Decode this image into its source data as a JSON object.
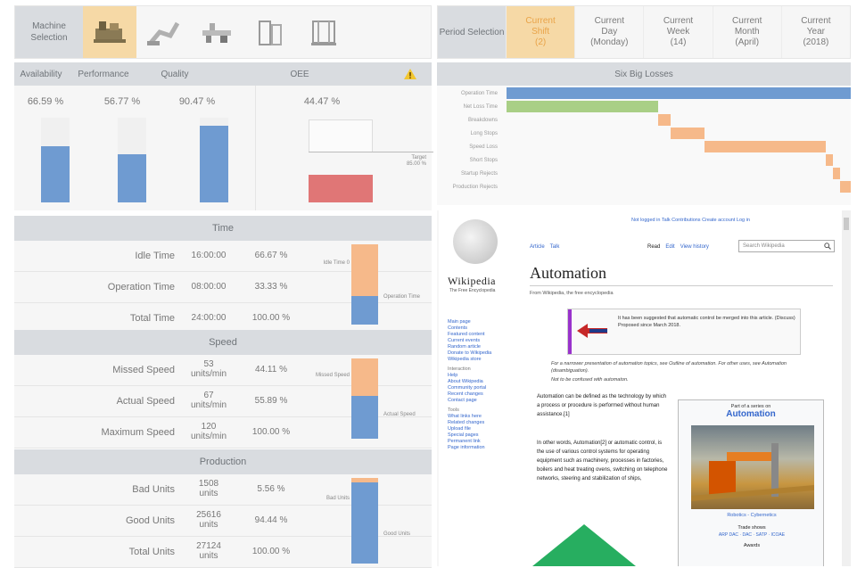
{
  "machine_selection": {
    "label": "Machine Selection"
  },
  "period_selection": {
    "label": "Period Selection",
    "items": [
      {
        "l1": "Current",
        "l2": "Shift",
        "l3": "(2)",
        "active": true
      },
      {
        "l1": "Current",
        "l2": "Day",
        "l3": "(Monday)"
      },
      {
        "l1": "Current",
        "l2": "Week",
        "l3": "(14)"
      },
      {
        "l1": "Current",
        "l2": "Month",
        "l3": "(April)"
      },
      {
        "l1": "Current",
        "l2": "Year",
        "l3": "(2018)"
      }
    ]
  },
  "kpi": {
    "headers": [
      "Availability",
      "Performance",
      "Quality",
      "OEE"
    ],
    "availability": "66.59 %",
    "performance": "56.77 %",
    "quality": "90.47 %",
    "oee": "44.47 %",
    "target_label": "Target",
    "target_value": "85.00 %",
    "warning_icon": "warning-icon"
  },
  "chart_data": {
    "type": "bar",
    "categories": [
      "Availability",
      "Performance",
      "Quality",
      "OEE"
    ],
    "values": [
      66.59,
      56.77,
      90.47,
      44.47
    ],
    "ylim": [
      0,
      100
    ]
  },
  "time": {
    "header": "Time",
    "rows": [
      {
        "label": "Idle Time",
        "value": "16:00:00",
        "pct": "66.67 %"
      },
      {
        "label": "Operation Time",
        "value": "08:00:00",
        "pct": "33.33 %"
      },
      {
        "label": "Total Time",
        "value": "24:00:00",
        "pct": "100.00 %"
      }
    ],
    "legend_top": "Idle Time 0",
    "legend_bottom": "Operation Time"
  },
  "speed": {
    "header": "Speed",
    "rows": [
      {
        "label": "Missed Speed",
        "v1": "53",
        "v2": "units/min",
        "pct": "44.11 %"
      },
      {
        "label": "Actual Speed",
        "v1": "67",
        "v2": "units/min",
        "pct": "55.89 %"
      },
      {
        "label": "Maximum Speed",
        "v1": "120",
        "v2": "units/min",
        "pct": "100.00 %"
      }
    ],
    "legend_top": "Missed Speed",
    "legend_bottom": "Actual Speed"
  },
  "production": {
    "header": "Production",
    "rows": [
      {
        "label": "Bad Units",
        "v1": "1508",
        "v2": "units",
        "pct": "5.56 %"
      },
      {
        "label": "Good Units",
        "v1": "25616",
        "v2": "units",
        "pct": "94.44 %"
      },
      {
        "label": "Total Units",
        "v1": "27124",
        "v2": "units",
        "pct": "100.00 %"
      }
    ],
    "legend_top": "Bad Units",
    "legend_bottom": "Good Units"
  },
  "losses": {
    "title": "Six Big Losses",
    "labels": [
      "Operation Time",
      "Net Loss Time",
      "Breakdowns",
      "Long Stops",
      "Speed Loss",
      "Short Stops",
      "Startup Rejects",
      "Production Rejects"
    ],
    "colors": {
      "blue": "#6f9bd1",
      "green": "#a9cf86",
      "orange": "#f6b98a"
    }
  },
  "wiki": {
    "top_links": "Not logged in  Talk  Contributions  Create account  Log in",
    "tabs": [
      "Article",
      "Talk"
    ],
    "actions": [
      "Read",
      "Edit",
      "View history"
    ],
    "search_placeholder": "Search Wikipedia",
    "logo": "Wikipedia",
    "logo_sub": "The Free Encyclopedia",
    "title": "Automation",
    "from": "From Wikipedia, the free encyclopedia",
    "merge_notice": "It has been suggested that automatic control be merged into this article. (Discuss) Proposed since March 2018.",
    "hatnote1": "For a narrower presentation of automation topics, see Outline of automation. For other uses, see Automation (disambiguation).",
    "hatnote2": "Not to be confused with automaton.",
    "body1": "Automation can be defined as the technology by which a process or procedure is performed without human assistance.[1]",
    "body2": "In other words, Automation[2] or automatic control, is the use of various control systems for operating equipment such as machinery, processes in factories, boilers and heat treating ovens, switching on telephone networks, steering and stabilization of ships,",
    "sidebar": [
      "Main page",
      "Contents",
      "Featured content",
      "Current events",
      "Random article",
      "Donate to Wikipedia",
      "Wikipedia store"
    ],
    "sidebar_head2": "Interaction",
    "sidebar2": [
      "Help",
      "About Wikipedia",
      "Community portal",
      "Recent changes",
      "Contact page"
    ],
    "sidebar_head3": "Tools",
    "sidebar3": [
      "What links here",
      "Related changes",
      "Upload file",
      "Special pages",
      "Permanent link",
      "Page information"
    ],
    "infobox_part": "Part of a series on",
    "infobox_title": "Automation",
    "caption": "Robotics - Cybernetics",
    "trade_title": "Trade shows",
    "trade_items": "ARP DAC · DAC · SATP · ICOAE",
    "awards": "Awards"
  }
}
